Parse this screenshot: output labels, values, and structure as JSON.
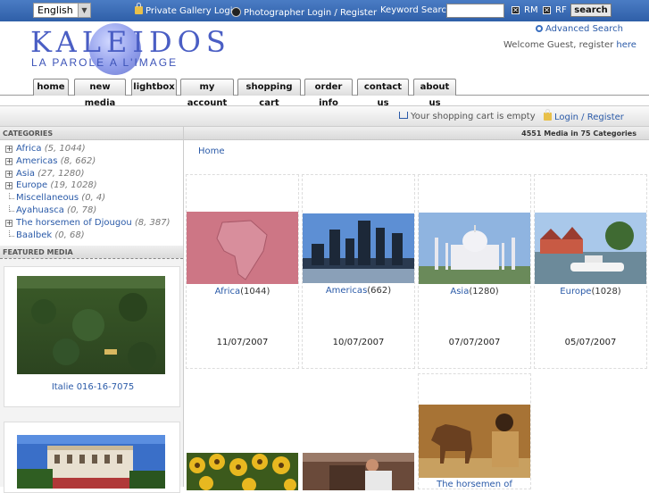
{
  "topbar": {
    "language": "English",
    "private_gallery_login": "Private Gallery Login",
    "photographer_login": "Photographer Login / Register",
    "keyword_search_label": "Keyword Search",
    "keyword_value": "",
    "rm_label": "RM",
    "rf_label": "RF",
    "search_button": "search"
  },
  "logo": {
    "name": "KALEIDOS",
    "tagline": "LA PAROLE A L'IMAGE"
  },
  "header": {
    "advanced_search": "Advanced Search",
    "welcome_text": "Welcome Guest, register",
    "welcome_link": "here"
  },
  "nav": {
    "tabs": [
      {
        "label": "home"
      },
      {
        "label": "new media"
      },
      {
        "label": "lightbox"
      },
      {
        "label": "my account"
      },
      {
        "label": "shopping cart"
      },
      {
        "label": "order info"
      },
      {
        "label": "contact us"
      },
      {
        "label": "about us"
      }
    ]
  },
  "cartbar": {
    "cart_status": "Your shopping cart is empty",
    "login_register": "Login / Register"
  },
  "sidebar": {
    "categories_title": "CATEGORIES",
    "categories": [
      {
        "name": "Africa",
        "count": "(5, 1044)",
        "expandable": true
      },
      {
        "name": "Americas",
        "count": "(8, 662)",
        "expandable": true
      },
      {
        "name": "Asia",
        "count": "(27, 1280)",
        "expandable": true
      },
      {
        "name": "Europe",
        "count": "(19, 1028)",
        "expandable": true
      },
      {
        "name": "Miscellaneous",
        "count": "(0, 4)",
        "expandable": false
      },
      {
        "name": "Ayahuasca",
        "count": "(0, 78)",
        "expandable": false
      },
      {
        "name": "The horsemen of Djougou",
        "count": "(8, 387)",
        "expandable": true
      },
      {
        "name": "Baalbek",
        "count": "(0, 68)",
        "expandable": false
      }
    ],
    "featured_title": "FEATURED MEDIA",
    "featured": [
      {
        "caption": "Italie 016-16-7075"
      },
      {
        "caption": ""
      }
    ]
  },
  "main": {
    "summary": "4551 Media in 75 Categories",
    "breadcrumb": "Home",
    "albums": [
      {
        "name": "Africa",
        "count": "(1044)",
        "date": "11/07/2007"
      },
      {
        "name": "Americas",
        "count": "(662)",
        "date": "10/07/2007"
      },
      {
        "name": "Asia",
        "count": "(1280)",
        "date": "07/07/2007"
      },
      {
        "name": "Europe",
        "count": "(1028)",
        "date": "05/07/2007"
      },
      {
        "name": "",
        "count": "",
        "date": ""
      },
      {
        "name": "",
        "count": "",
        "date": ""
      },
      {
        "name": "The horsemen of",
        "count": "",
        "date": ""
      }
    ]
  },
  "colors": {
    "topbar": "#2f5fa8",
    "link": "#2a5aa8",
    "logo": "#4a5ec4"
  }
}
